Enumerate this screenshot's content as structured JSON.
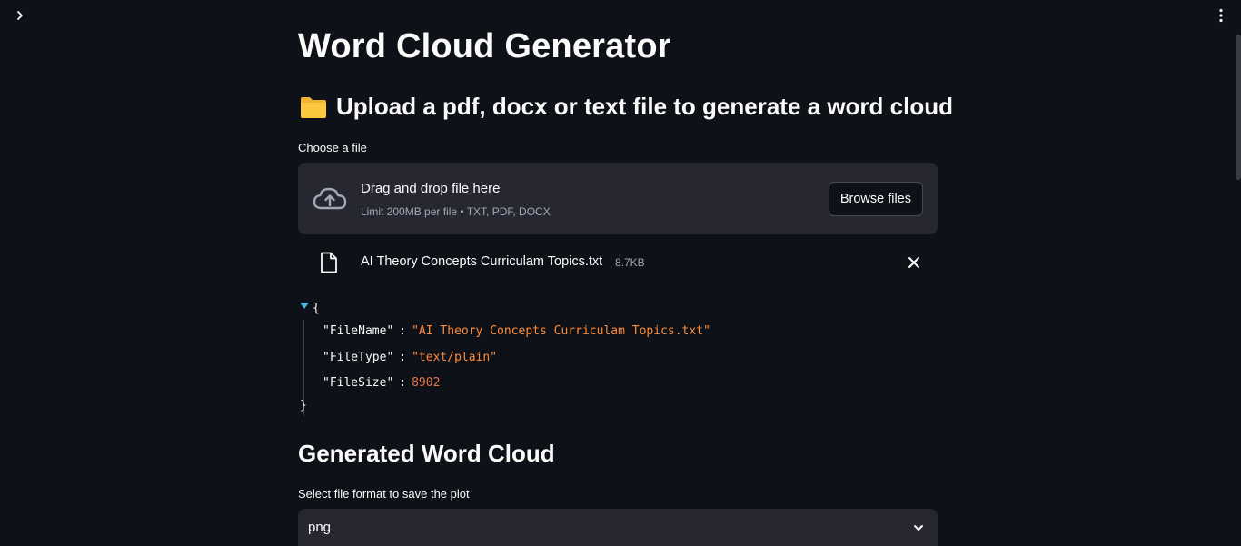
{
  "app": {
    "title": "Word Cloud Generator",
    "subtitle": "Upload a pdf, docx or text file to generate a word cloud"
  },
  "uploader": {
    "label": "Choose a file",
    "drop_title": "Drag and drop file here",
    "drop_limit": "Limit 200MB per file • TXT, PDF, DOCX",
    "browse_label": "Browse files",
    "uploaded_file": {
      "name": "AI Theory Concepts Curriculam Topics.txt",
      "size": "8.7KB"
    }
  },
  "json_view": {
    "open_brace": "{",
    "close_brace": "}",
    "rows": [
      {
        "key": "\"FileName\"",
        "colon": ":",
        "value": "\"AI Theory Concepts Curriculam Topics.txt\""
      },
      {
        "key": "\"FileType\"",
        "colon": ":",
        "value": "\"text/plain\""
      },
      {
        "key": "\"FileSize\"",
        "colon": ":",
        "value": "8902"
      }
    ]
  },
  "word_cloud": {
    "heading": "Generated Word Cloud",
    "format_label": "Select file format to save the plot",
    "format_value": "png"
  },
  "icons": {
    "sidebar_toggle": "chevron-right-icon",
    "menu": "vertical-dots-icon",
    "folder": "folder-icon",
    "upload": "cloud-upload-icon",
    "file": "file-icon",
    "remove": "close-icon",
    "json_toggle": "triangle-down-icon",
    "select": "chevron-down-icon"
  },
  "colors": {
    "background": "#0e1117",
    "surface": "#262730",
    "json_string": "#ff8c3a",
    "json_number": "#e3744b",
    "json_toggle": "#4db4e4"
  }
}
